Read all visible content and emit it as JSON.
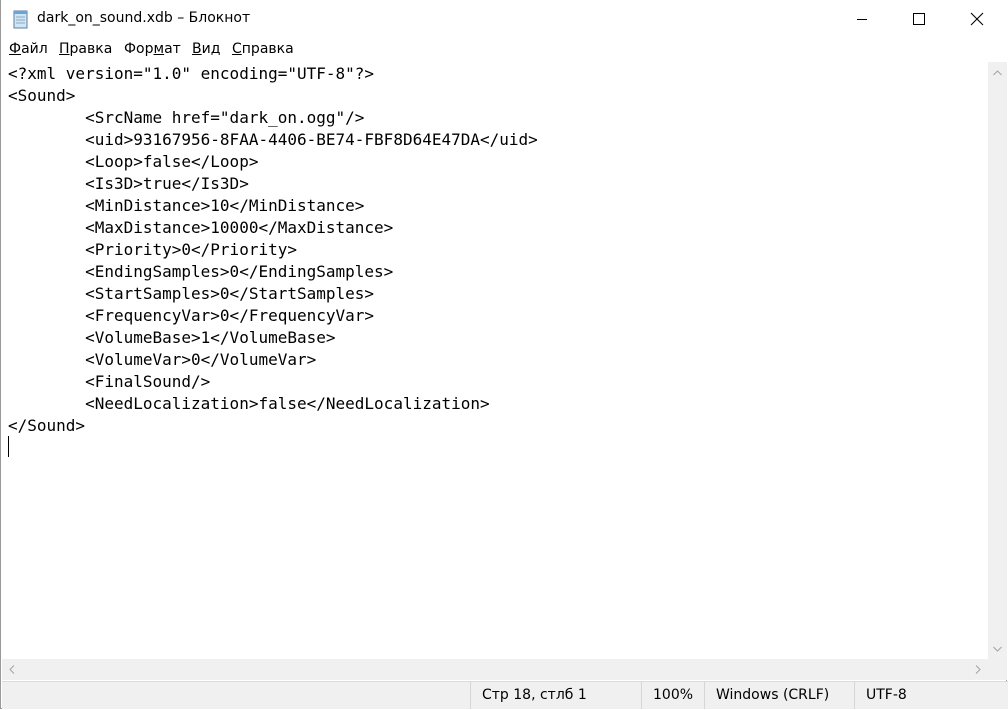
{
  "window": {
    "title": "dark_on_sound.xdb – Блокнот",
    "minimize_icon": "minimize-icon",
    "maximize_icon": "maximize-icon",
    "close_icon": "close-icon"
  },
  "menu": {
    "items": [
      {
        "accel": "Ф",
        "rest": "айл",
        "pre": ""
      },
      {
        "accel": "П",
        "rest": "равка",
        "pre": ""
      },
      {
        "pre": "Фор",
        "accel": "м",
        "rest": "ат"
      },
      {
        "accel": "В",
        "rest": "ид",
        "pre": ""
      },
      {
        "accel": "С",
        "rest": "правка",
        "pre": ""
      }
    ]
  },
  "editor": {
    "lines": [
      "<?xml version=\"1.0\" encoding=\"UTF-8\"?>",
      "<Sound>",
      "\t<SrcName href=\"dark_on.ogg\"/>",
      "\t<uid>93167956-8FAA-4406-BE74-FBF8D64E47DA</uid>",
      "\t<Loop>false</Loop>",
      "\t<Is3D>true</Is3D>",
      "\t<MinDistance>10</MinDistance>",
      "\t<MaxDistance>10000</MaxDistance>",
      "\t<Priority>0</Priority>",
      "\t<EndingSamples>0</EndingSamples>",
      "\t<StartSamples>0</StartSamples>",
      "\t<FrequencyVar>0</FrequencyVar>",
      "\t<VolumeBase>1</VolumeBase>",
      "\t<VolumeVar>0</VolumeVar>",
      "\t<FinalSound/>",
      "\t<NeedLocalization>false</NeedLocalization>",
      "</Sound>",
      ""
    ]
  },
  "status": {
    "position": "Стр 18, стлб 1",
    "zoom": "100%",
    "line_endings": "Windows (CRLF)",
    "encoding": "UTF-8"
  },
  "colors": {
    "chrome": "#f0f0f0",
    "text": "#000000",
    "background": "#ffffff"
  }
}
